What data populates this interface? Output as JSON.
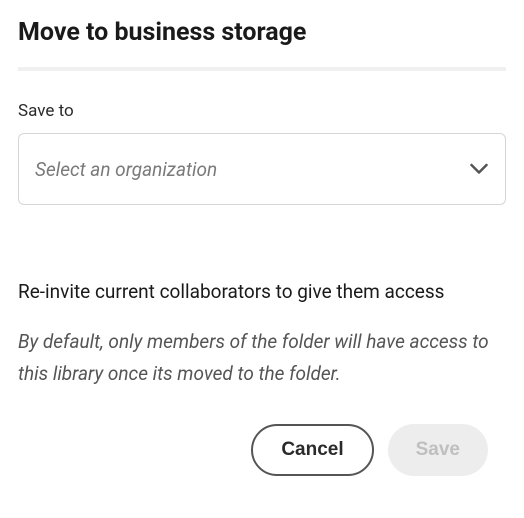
{
  "dialog": {
    "title": "Move to business storage"
  },
  "field": {
    "label": "Save to",
    "placeholder": "Select an organization"
  },
  "reInvite": {
    "heading": "Re-invite current collaborators to give them access",
    "description": "By default, only members of the folder will have access to this library once its moved to the folder."
  },
  "buttons": {
    "cancel": "Cancel",
    "save": "Save"
  }
}
